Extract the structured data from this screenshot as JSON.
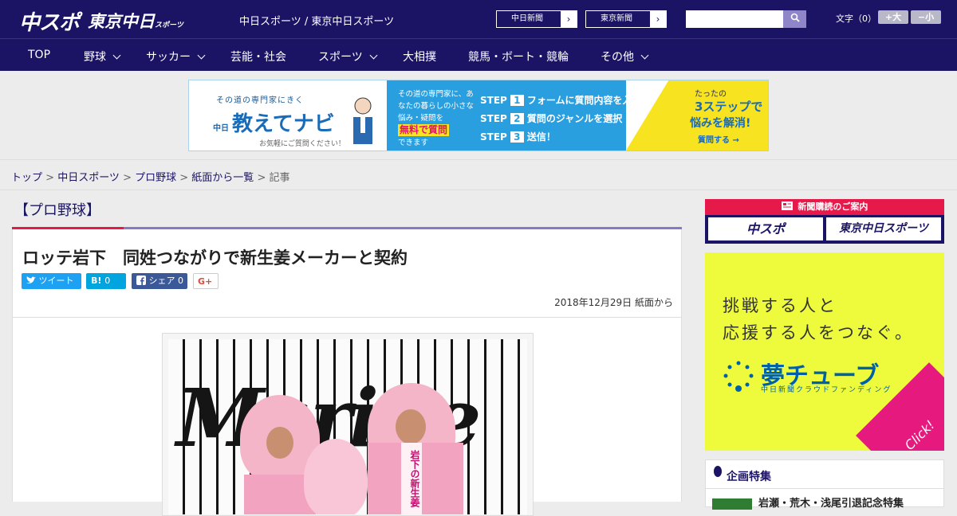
{
  "header": {
    "logo_chuspo": "中スポ",
    "logo_tokyo": "東京中日",
    "logo_tokyo_sub": "スポーツ",
    "site_title": "中日スポーツ / 東京中日スポーツ",
    "paper_btn_chunichi": "中日新聞",
    "paper_btn_tokyo": "東京新聞",
    "search_placeholder": "",
    "fontsize_label": "文字（0）",
    "font_larger": "+大",
    "font_smaller": "−小"
  },
  "nav": {
    "items": [
      {
        "label": "TOP"
      },
      {
        "label": "野球"
      },
      {
        "label": "サッカー"
      },
      {
        "label": "芸能・社会"
      },
      {
        "label": "スポーツ"
      },
      {
        "label": "大相撲"
      },
      {
        "label": "競馬・ボート・競輪"
      },
      {
        "label": "その他"
      }
    ]
  },
  "top_banner": {
    "small": "その道の専門家にきく",
    "brand_prefix": "中日",
    "brand": "教えてナビ",
    "caption": "お気軽にご質問ください！",
    "mid_text": "その道の専門家に、あなたの暮らしの小さな悩み・疑問を",
    "highlight": "無料で質問",
    "mid_end": "できます",
    "step_word": "STEP",
    "steps": [
      {
        "num": "1",
        "text": "フォームに質問内容を入力"
      },
      {
        "num": "2",
        "text": "質問のジャンルを選択"
      },
      {
        "num": "3",
        "text": "送信！"
      }
    ],
    "right1": "たったの",
    "right2": "3ステップで",
    "right3": "悩みを解消!",
    "cta": "質問する →"
  },
  "breadcrumb": {
    "items": [
      "トップ",
      "中日スポーツ",
      "プロ野球",
      "紙面から一覧"
    ],
    "separator": " > ",
    "current": "記事"
  },
  "article": {
    "category": "【プロ野球】",
    "headline": "ロッテ岩下　同姓つながりで新生姜メーカーと契約",
    "tweet_label": "ツイート",
    "hatebu_label": "B!",
    "hatebu_count": "0",
    "fb_label": "シェア",
    "fb_count": "0",
    "gplus_label": "G+",
    "date": "2018年12月29日 紙面から",
    "photo_bg_text": "Marine",
    "photo_sign": "岩下の新生姜"
  },
  "sidebar": {
    "subscribe_title": "新聞購読のご案内",
    "subscribe_chuspo": "中スポ",
    "subscribe_tokyo": "東京中日スポーツ",
    "yume_line1": "挑戦する人と",
    "yume_line2": "応援する人をつなぐ。",
    "yume_logo": "夢チューブ",
    "yume_sub": "中日新聞クラウドファンディング",
    "yume_click": "Click!",
    "feature_title": "企画特集",
    "feature_item": "岩瀬・荒木・浅尾引退記念特集"
  },
  "colors": {
    "brand_navy": "#1b1464",
    "accent_red": "#e6194b",
    "twitter": "#1da1f2",
    "facebook": "#3b5998"
  }
}
